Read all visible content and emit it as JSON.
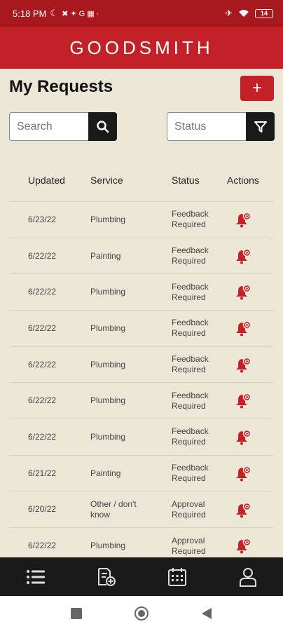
{
  "status_bar": {
    "time": "5:18 PM",
    "battery": "14"
  },
  "header": {
    "brand": "GOODSMITH"
  },
  "main": {
    "title": "My Requests",
    "add_label": "+",
    "search": {
      "placeholder": "Search",
      "value": ""
    },
    "status_filter": {
      "placeholder": "Status",
      "value": ""
    }
  },
  "table": {
    "headers": {
      "updated": "Updated",
      "service": "Service",
      "status": "Status",
      "actions": "Actions"
    },
    "rows": [
      {
        "updated": "6/23/22",
        "service": "Plumbing",
        "status": "Feedback Required"
      },
      {
        "updated": "6/22/22",
        "service": "Painting",
        "status": "Feedback Required"
      },
      {
        "updated": "6/22/22",
        "service": "Plumbing",
        "status": "Feedback Required"
      },
      {
        "updated": "6/22/22",
        "service": "Plumbing",
        "status": "Feedback Required"
      },
      {
        "updated": "6/22/22",
        "service": "Plumbing",
        "status": "Feedback Required"
      },
      {
        "updated": "6/22/22",
        "service": "Plumbing",
        "status": "Feedback Required"
      },
      {
        "updated": "6/22/22",
        "service": "Plumbing",
        "status": "Feedback Required"
      },
      {
        "updated": "6/21/22",
        "service": "Painting",
        "status": "Feedback Required"
      },
      {
        "updated": "6/20/22",
        "service": "Other / don't know",
        "status": "Approval Required"
      },
      {
        "updated": "6/22/22",
        "service": "Plumbing",
        "status": "Approval Required"
      }
    ]
  },
  "bottom_nav": [
    "list-icon",
    "add-document-icon",
    "calendar-icon",
    "profile-icon"
  ],
  "colors": {
    "brand_red": "#c42027",
    "status_bar": "#a8191f",
    "background": "#ece6d6",
    "nav": "#1a1a1a"
  }
}
